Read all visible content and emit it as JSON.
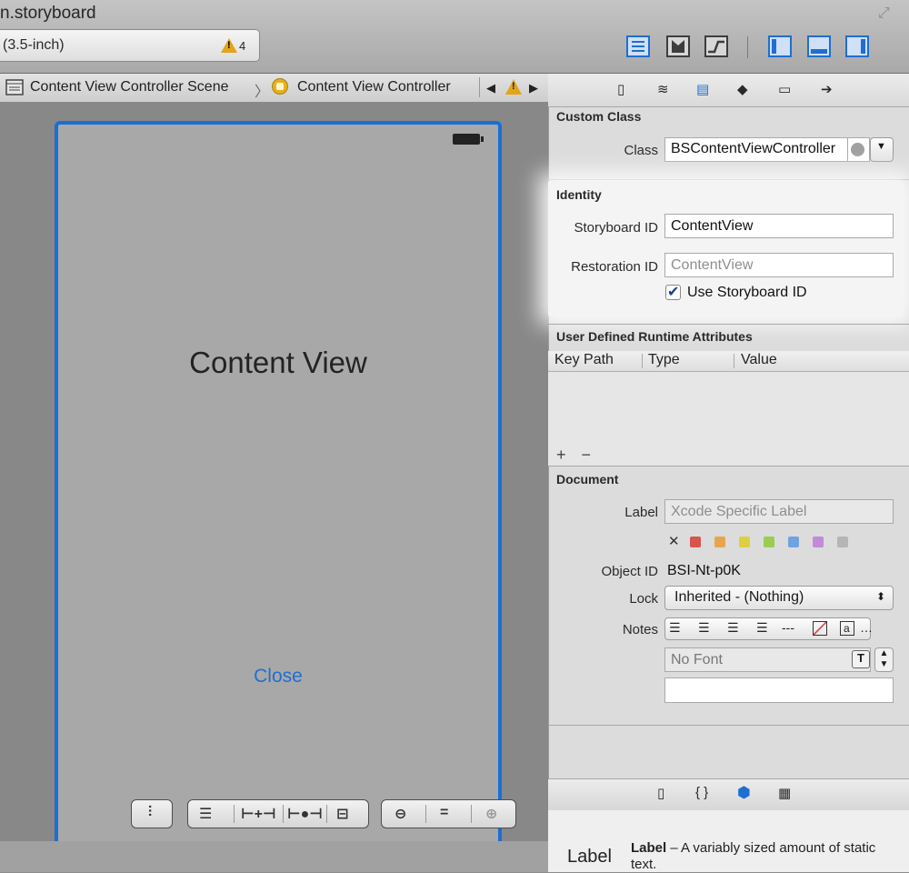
{
  "window": {
    "title": "n.storyboard"
  },
  "toolbar": {
    "scheme": "(3.5-inch)",
    "warnings": "4",
    "warning_glyph": "!",
    "editor_buttons": [
      "standard-editor",
      "assistant-editor",
      "version-editor"
    ],
    "panel_buttons": [
      "navigator-panel",
      "debug-panel",
      "utilities-panel"
    ]
  },
  "jumpbar": {
    "scene": "Content View Controller Scene",
    "separator": "〉",
    "controller": "Content View Controller",
    "back": "◀",
    "forward": "▶",
    "warn": "!"
  },
  "canvas": {
    "view_title": "Content View",
    "close_button": "Close",
    "fit_buttons": {
      "resize": "⫶",
      "align": "☰",
      "pin": "⊢+⊣",
      "resolve": "⊢●⊣",
      "embed": "⊟",
      "zoom_out": "⊖",
      "zoom_actual": "=",
      "zoom_in": "⊕"
    }
  },
  "inspector": {
    "tabs": [
      "file-inspector",
      "quick-help",
      "identity-inspector",
      "attributes-inspector",
      "size-inspector",
      "connections-inspector"
    ],
    "tab_glyphs": [
      "▯",
      "≋",
      "▤",
      "◆",
      "▭",
      "➔"
    ],
    "custom_class": {
      "title": "Custom Class",
      "class_label": "Class",
      "class_value": "BSContentViewController"
    },
    "identity": {
      "title": "Identity",
      "storyboard_id_label": "Storyboard ID",
      "storyboard_id_value": "ContentView",
      "restoration_id_label": "Restoration ID",
      "restoration_id_placeholder": "ContentView",
      "use_storyboard_id_label": "Use Storyboard ID",
      "use_storyboard_id_checked": true,
      "checkmark": "✔"
    },
    "runtime_attributes": {
      "title": "User Defined Runtime Attributes",
      "columns": [
        "Key Path",
        "Type",
        "Value"
      ],
      "add": "+",
      "remove": "−"
    },
    "document": {
      "title": "Document",
      "label_label": "Label",
      "label_placeholder": "Xcode Specific Label",
      "clear_glyph": "✕",
      "label_colors": [
        "#d9534f",
        "#e8a550",
        "#ddd040",
        "#9ccc52",
        "#6fa3e0",
        "#c28ad9",
        "#b5b5b5"
      ],
      "object_id_label": "Object ID",
      "object_id_value": "BSI-Nt-p0K",
      "lock_label": "Lock",
      "lock_value": "Inherited - (Nothing)",
      "notes_label": "Notes",
      "notes_font": "No Font",
      "notes_text": ""
    },
    "library": {
      "tabs": [
        "file-template-library",
        "code-snippet-library",
        "object-library",
        "media-library"
      ],
      "tab_glyphs": [
        "▯",
        "{ }",
        "⬢",
        "▦"
      ],
      "item_icon_text": "Label",
      "item_title": "Label",
      "item_description": " – A variably sized amount of static text."
    }
  }
}
